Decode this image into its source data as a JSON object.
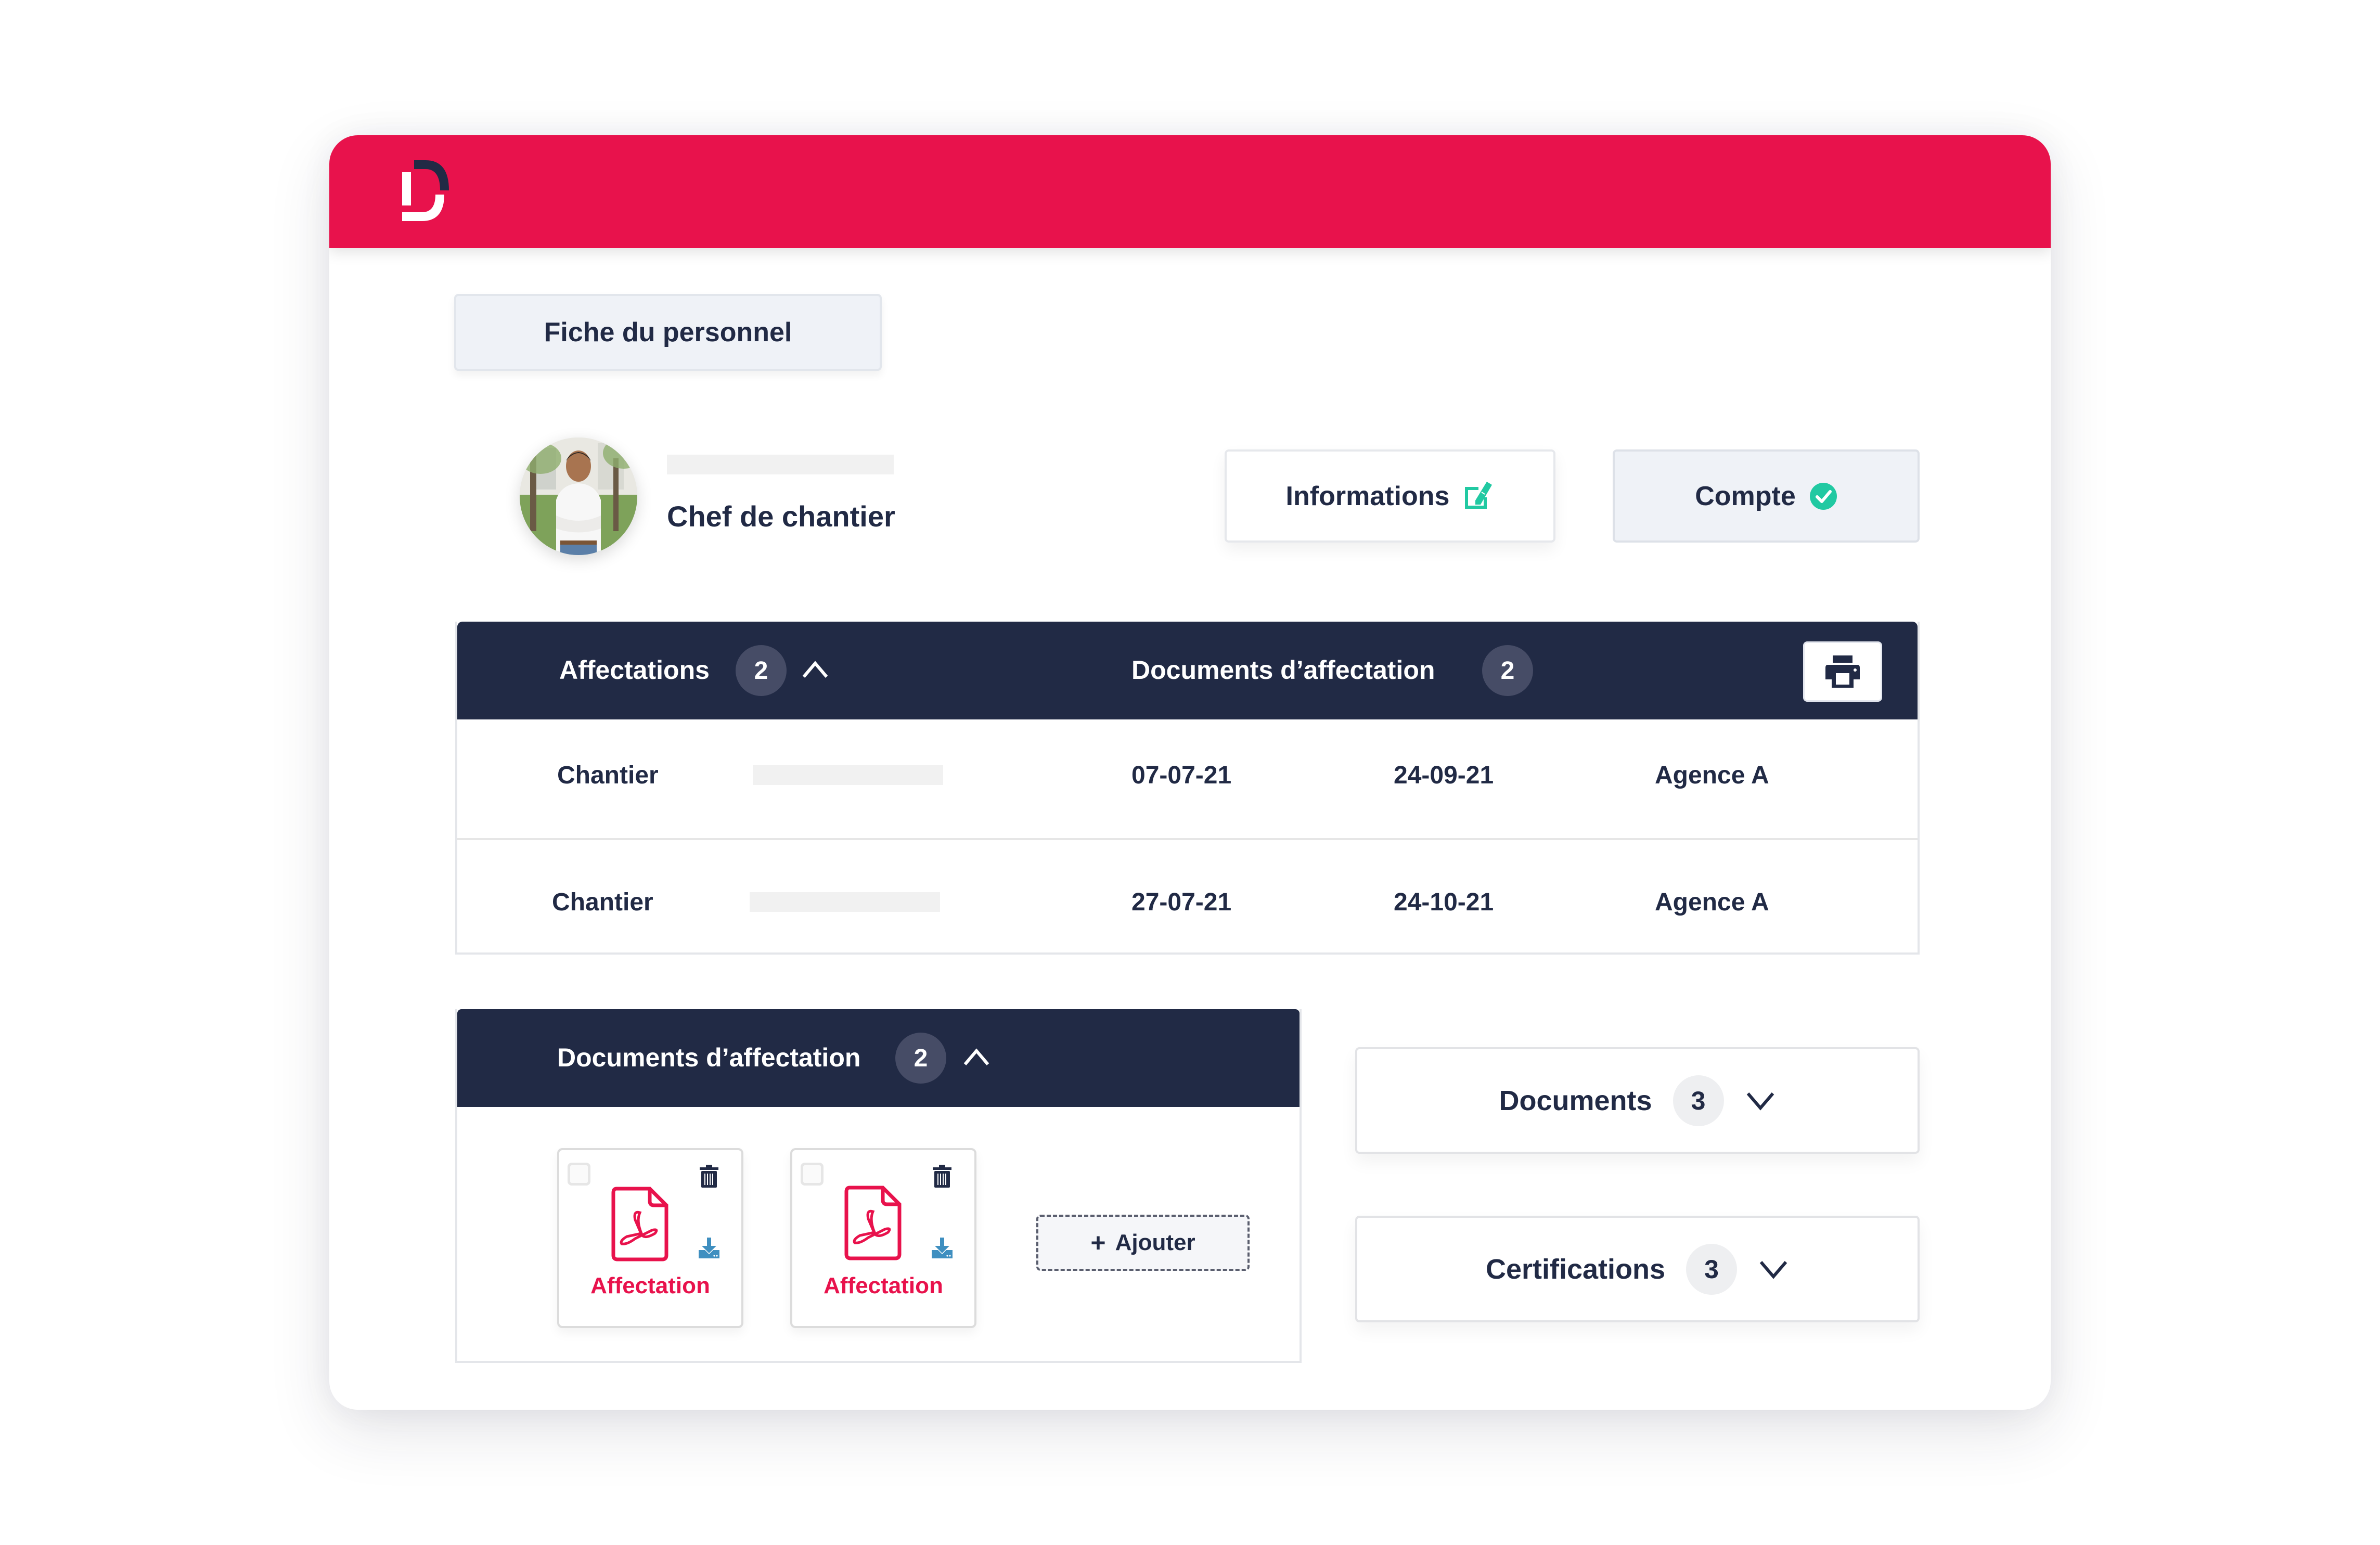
{
  "brand": {
    "logo_icon": "d-logo-icon",
    "colors": {
      "primary": "#e8124c",
      "navy": "#212a45",
      "accent_green": "#21c9a2",
      "download_blue": "#3f8fc0",
      "badge_dark": "#464c66",
      "badge_light": "#eeeff1"
    }
  },
  "page": {
    "tab_label": "Fiche du personnel"
  },
  "profile": {
    "name_placeholder": "",
    "role": "Chef de chantier",
    "avatar_icon": "person-photo"
  },
  "actions": {
    "informations_label": "Informations",
    "informations_icon": "edit-icon",
    "compte_label": "Compte",
    "compte_icon": "check-circle-icon"
  },
  "ghost_badge": "2",
  "affectations": {
    "label": "Affectations",
    "count": "2",
    "toggle_icon": "chevron-up-icon",
    "documents_label": "Documents d’affectation",
    "documents_count": "2",
    "print_icon": "printer-icon",
    "rows": [
      {
        "type": "Chantier",
        "name": "",
        "start": "07-07-21",
        "end": "24-09-21",
        "agency": "Agence A"
      },
      {
        "type": "Chantier",
        "name": "",
        "start": "27-07-21",
        "end": "24-10-21",
        "agency": "Agence A"
      }
    ]
  },
  "documents_affectation": {
    "label": "Documents d’affectation",
    "count": "2",
    "toggle_icon": "chevron-up-icon",
    "files": [
      {
        "name": "Affectation",
        "icon": "pdf-file-icon",
        "checked": false
      },
      {
        "name": "Affectation",
        "icon": "pdf-file-icon",
        "checked": false
      }
    ],
    "add_label": "Ajouter",
    "add_icon": "plus-icon"
  },
  "side_panels": [
    {
      "label": "Documents",
      "count": "3",
      "toggle_icon": "chevron-down-icon"
    },
    {
      "label": "Certifications",
      "count": "3",
      "toggle_icon": "chevron-down-icon"
    }
  ]
}
